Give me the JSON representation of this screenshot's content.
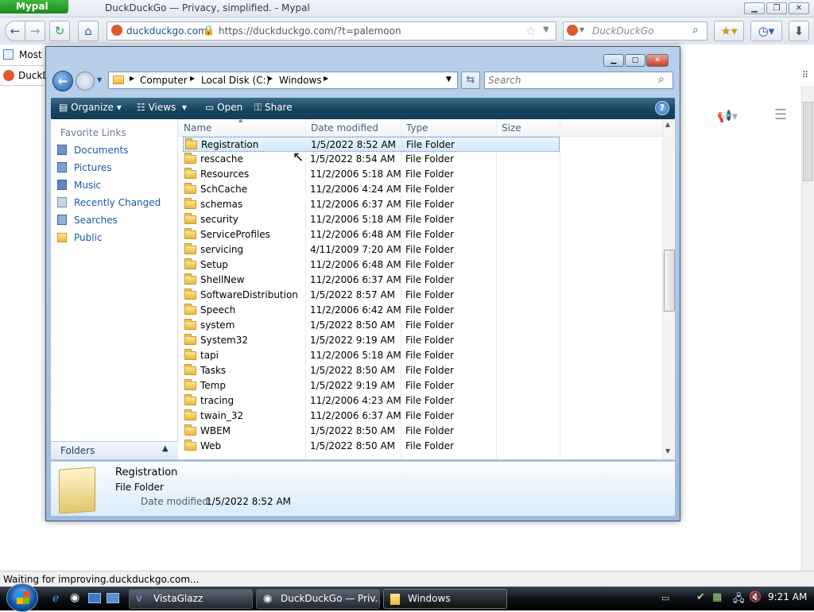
{
  "browser": {
    "app_button": "Mypal",
    "window_title": "DuckDuckGo — Privacy, simplified. - Mypal",
    "url_site": "duckduckgo.com",
    "url": "https://duckduckgo.com/?t=palemoon",
    "search_placeholder": "DuckDuckGo",
    "bookmark_label": "Most",
    "tab_label": "DuckD",
    "status_text": "Waiting for improving.duckduckgo.com..."
  },
  "explorer": {
    "breadcrumb": [
      "Computer",
      "Local Disk (C:)",
      "Windows"
    ],
    "search_placeholder": "Search",
    "commands": {
      "organize": "Organize",
      "views": "Views",
      "open": "Open",
      "share": "Share"
    },
    "favorite_links_header": "Favorite Links",
    "favorite_links": [
      "Documents",
      "Pictures",
      "Music",
      "Recently Changed",
      "Searches",
      "Public"
    ],
    "folders_label": "Folders",
    "columns": [
      "Name",
      "Date modified",
      "Type",
      "Size"
    ],
    "files": [
      {
        "name": "Registration",
        "date": "1/5/2022 8:52 AM",
        "type": "File Folder"
      },
      {
        "name": "rescache",
        "date": "1/5/2022 8:54 AM",
        "type": "File Folder"
      },
      {
        "name": "Resources",
        "date": "11/2/2006 5:18 AM",
        "type": "File Folder"
      },
      {
        "name": "SchCache",
        "date": "11/2/2006 4:24 AM",
        "type": "File Folder"
      },
      {
        "name": "schemas",
        "date": "11/2/2006 6:37 AM",
        "type": "File Folder"
      },
      {
        "name": "security",
        "date": "11/2/2006 5:18 AM",
        "type": "File Folder"
      },
      {
        "name": "ServiceProfiles",
        "date": "11/2/2006 6:48 AM",
        "type": "File Folder"
      },
      {
        "name": "servicing",
        "date": "4/11/2009 7:20 AM",
        "type": "File Folder"
      },
      {
        "name": "Setup",
        "date": "11/2/2006 6:48 AM",
        "type": "File Folder"
      },
      {
        "name": "ShellNew",
        "date": "11/2/2006 6:37 AM",
        "type": "File Folder"
      },
      {
        "name": "SoftwareDistribution",
        "date": "1/5/2022 8:57 AM",
        "type": "File Folder"
      },
      {
        "name": "Speech",
        "date": "11/2/2006 6:42 AM",
        "type": "File Folder"
      },
      {
        "name": "system",
        "date": "1/5/2022 8:50 AM",
        "type": "File Folder"
      },
      {
        "name": "System32",
        "date": "1/5/2022 9:19 AM",
        "type": "File Folder"
      },
      {
        "name": "tapi",
        "date": "11/2/2006 5:18 AM",
        "type": "File Folder"
      },
      {
        "name": "Tasks",
        "date": "1/5/2022 8:50 AM",
        "type": "File Folder"
      },
      {
        "name": "Temp",
        "date": "1/5/2022 9:19 AM",
        "type": "File Folder"
      },
      {
        "name": "tracing",
        "date": "11/2/2006 4:23 AM",
        "type": "File Folder"
      },
      {
        "name": "twain_32",
        "date": "11/2/2006 6:37 AM",
        "type": "File Folder"
      },
      {
        "name": "WBEM",
        "date": "1/5/2022 8:50 AM",
        "type": "File Folder"
      },
      {
        "name": "Web",
        "date": "1/5/2022 8:50 AM",
        "type": "File Folder"
      }
    ],
    "details": {
      "name": "Registration",
      "type": "File Folder",
      "date_label": "Date modified:",
      "date_value": "1/5/2022 8:52 AM"
    }
  },
  "taskbar": {
    "buttons": [
      "VistaGlazz",
      "DuckDuckGo — Priv...",
      "Windows"
    ],
    "clock": "9:21 AM"
  }
}
